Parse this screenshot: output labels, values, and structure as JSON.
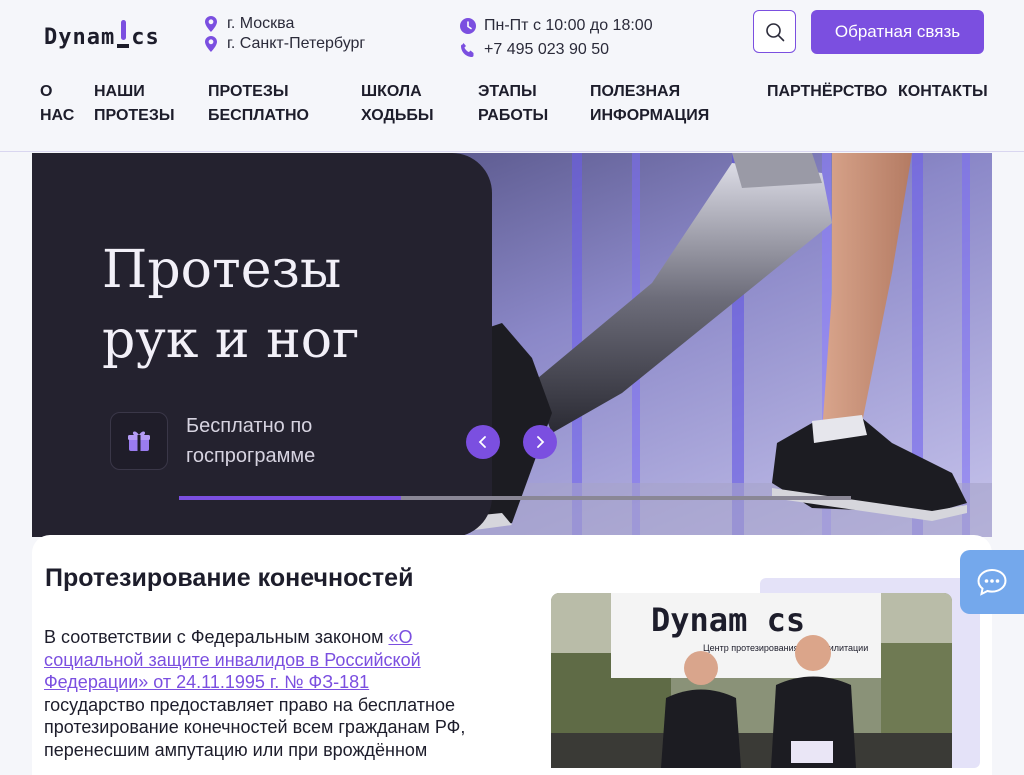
{
  "brand": {
    "logo_prefix": "Dynam",
    "logo_suffix": "cs",
    "accent": "#7b4fe0"
  },
  "header": {
    "cities": [
      "г. Москва",
      "г. Санкт-Петербург"
    ],
    "hours": "Пн-Пт с 10:00 до 18:00",
    "phone": "+7 495 023 90 50",
    "search_icon": "search-icon",
    "feedback_label": "Обратная связь"
  },
  "nav": [
    {
      "line1": "О",
      "line2": "НАС"
    },
    {
      "line1": "НАШИ",
      "line2": "ПРОТЕЗЫ"
    },
    {
      "line1": "ПРОТЕЗЫ",
      "line2": "БЕСПЛАТНО"
    },
    {
      "line1": "ШКОЛА",
      "line2": "ХОДЬБЫ"
    },
    {
      "line1": "ЭТАПЫ",
      "line2": "РАБОТЫ"
    },
    {
      "line1": "ПОЛЕЗНАЯ",
      "line2": "ИНФОРМАЦИЯ"
    },
    {
      "line1": "ПАРТНЁРСТВО",
      "line2": ""
    },
    {
      "line1": "КОНТАКТЫ",
      "line2": ""
    }
  ],
  "hero": {
    "title": "Протезы\nрук и ног",
    "subtitle": "Бесплатно по госпрограмме",
    "gift_icon": "gift-icon",
    "slider_progress": 0.33
  },
  "section": {
    "title": "Протезирование конечностей",
    "text_before": "В соответствии с Федеральным законом ",
    "link_text": "«О социальной защите инвалидов в Российской Федерации» от 24.11.1995 г. № ФЗ-181",
    "text_after": " государство предоставляет право на бесплатное протезирование конечностей всем гражданам РФ, перенесшим ампутацию или при врождённом"
  },
  "photo": {
    "banner_text": "Dynam cs",
    "banner_sub": "Центр протезирования и реабилитации"
  },
  "chat": {
    "icon": "chat-icon"
  }
}
